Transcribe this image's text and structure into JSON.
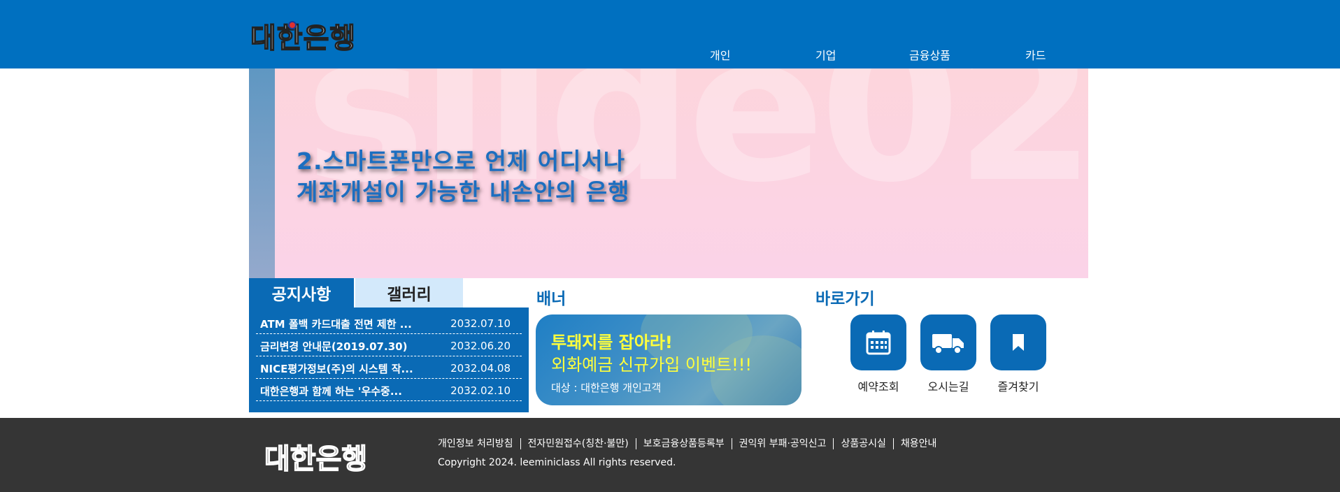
{
  "header": {
    "logo_text": "대한은행",
    "nav": [
      {
        "label": "개인"
      },
      {
        "label": "기업"
      },
      {
        "label": "금융상품"
      },
      {
        "label": "카드"
      }
    ]
  },
  "slider": {
    "watermark": "slide02",
    "line1": "2.스마트폰만으로 언제 어디서나",
    "line2": "계좌개설이 가능한 내손안의 은행"
  },
  "notice": {
    "tabs": [
      {
        "label": "공지사항"
      },
      {
        "label": "갤러리"
      }
    ],
    "items": [
      {
        "title": "ATM 폴백 카드대출 전면 제한 ...",
        "date": "2032.07.10"
      },
      {
        "title": "금리변경 안내문(2019.07.30)",
        "date": "2032.06.20"
      },
      {
        "title": "NICE평가정보(주)의 시스템 작...",
        "date": "2032.04.08"
      },
      {
        "title": "대한은행과 함께 하는 '우수중...",
        "date": "2032.02.10"
      }
    ]
  },
  "banner": {
    "title": "배너",
    "headline": "투돼지를 잡아라!",
    "subheadline": "외화예금 신규가입 이벤트!!!",
    "target": "대상 : 대한은행 개인고객"
  },
  "quick": {
    "title": "바로가기",
    "items": [
      {
        "label": "예약조회",
        "icon": "calendar-icon"
      },
      {
        "label": "오시는길",
        "icon": "truck-icon"
      },
      {
        "label": "즐겨찾기",
        "icon": "bookmark-icon"
      }
    ]
  },
  "footer": {
    "logo_text": "대한은행",
    "links": [
      {
        "label": "개인정보 처리방침"
      },
      {
        "label": "전자민원접수(칭찬·불만)"
      },
      {
        "label": "보호금융상품등록부"
      },
      {
        "label": "권익위 부패·공익신고"
      },
      {
        "label": "상품공시실"
      },
      {
        "label": "채용안내"
      }
    ],
    "copyright": "Copyright 2024. leeminiclass All rights reserved."
  },
  "colors": {
    "primary": "#0070c0",
    "panel_blue": "#0a6ab5",
    "tab_light": "#d3e9fb",
    "banner_yellow": "#ffff3c",
    "footer_bg": "#353535"
  }
}
